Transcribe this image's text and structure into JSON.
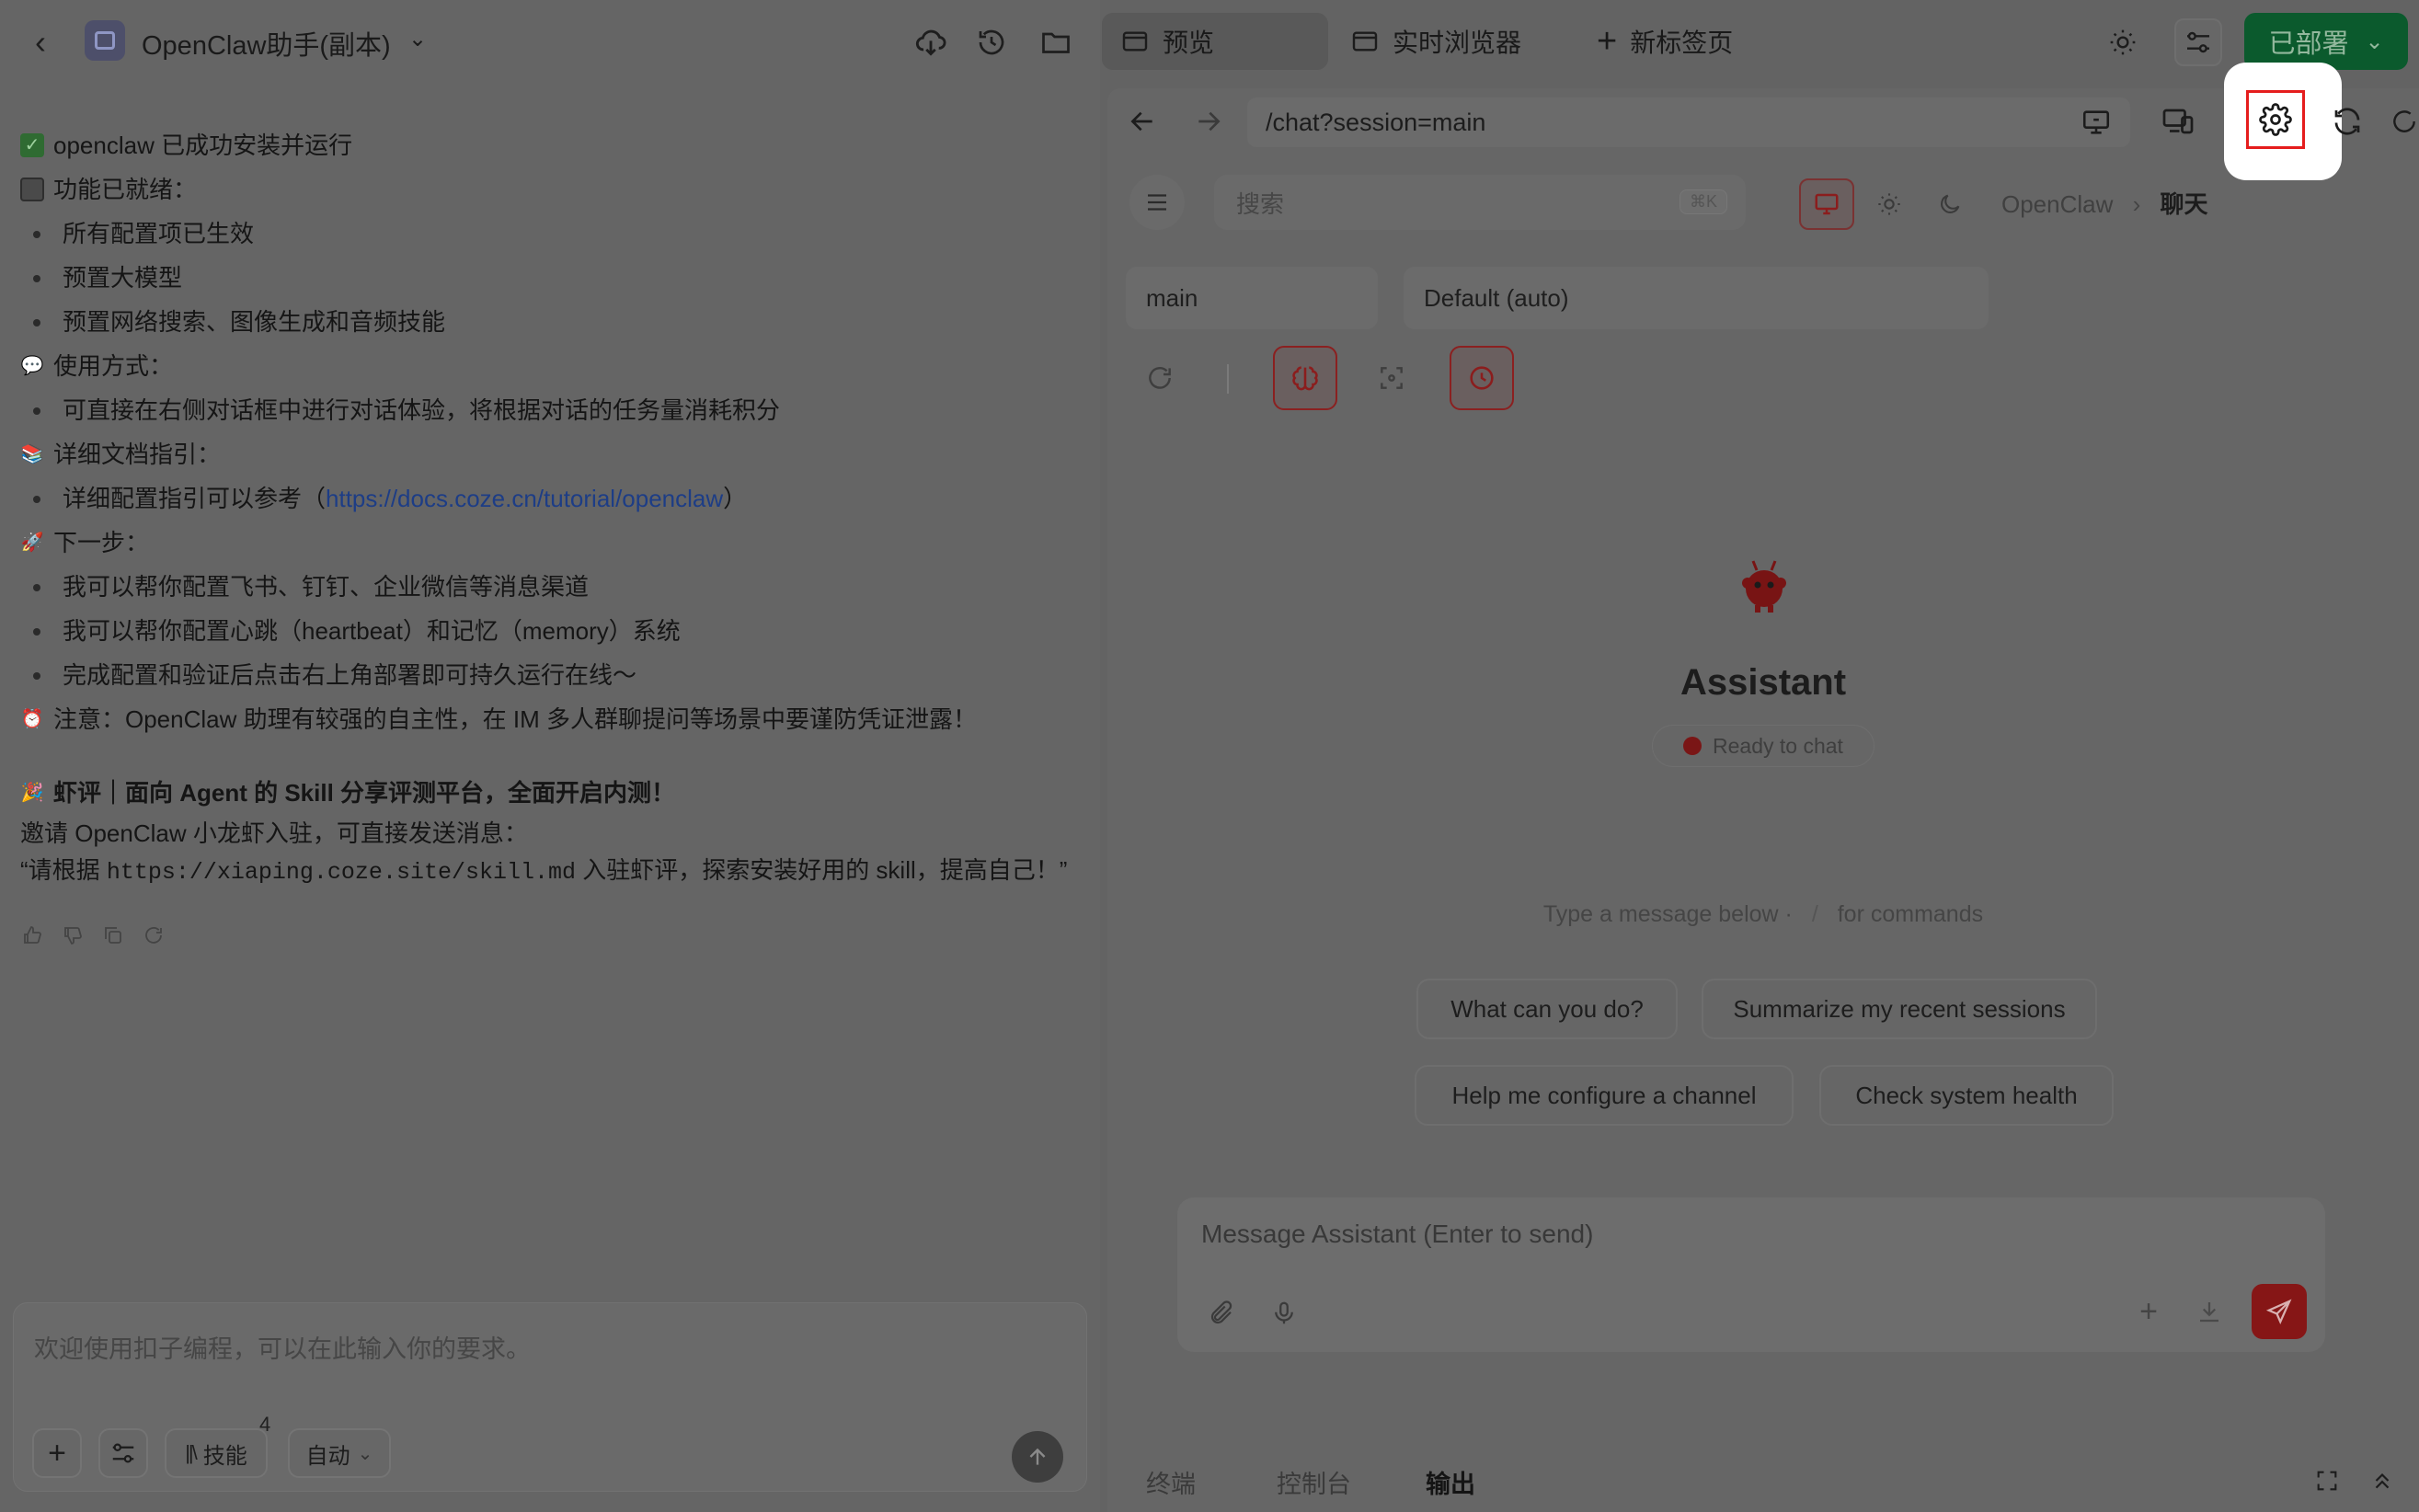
{
  "left": {
    "back_glyph": "‹",
    "project_title": "OpenClaw助手(副本)",
    "chevron": "⌄",
    "messages": {
      "line1": "openclaw 已成功安装并运行",
      "line2": "功能已就绪：",
      "bullets1": [
        "所有配置项已生效",
        "预置大模型",
        "预置网络搜索、图像生成和音频技能"
      ],
      "usage_title": "使用方式：",
      "usage_bullet": "可直接在右侧对话框中进行对话体验，将根据对话的任务量消耗积分",
      "docs_title": "详细文档指引：",
      "docs_prefix": "详细配置指引可以参考（",
      "docs_link": "https://docs.coze.cn/tutorial/openclaw",
      "docs_suffix": "）",
      "next_title": "下一步：",
      "next_bullets": [
        "我可以帮你配置飞书、钉钉、企业微信等消息渠道",
        "我可以帮你配置心跳（heartbeat）和记忆（memory）系统",
        "完成配置和验证后点击右上角部署即可持久运行在线～"
      ],
      "warning": "注意：OpenClaw 助理有较强的自主性，在 IM 多人群聊提问等场景中要谨防凭证泄露！",
      "promo_title": "虾评｜面向 Agent 的 Skill 分享评测平台，全面开启内测！",
      "invite": "邀请 OpenClaw 小龙虾入驻，可直接发送消息：",
      "quote_prefix": "“请根据 ",
      "quote_code": "https://xiaping.coze.site/skill.md",
      "quote_suffix": " 入驻虾评，探索安装好用的 skill，提高自己！”"
    },
    "composer": {
      "placeholder": "欢迎使用扣子编程，可以在此输入你的要求。",
      "add": "+",
      "skills_label": "技能",
      "skills_count": "4",
      "mode_label": "自动",
      "mode_chevron": "⌄"
    }
  },
  "right": {
    "tabs": [
      {
        "label": "预览"
      },
      {
        "label": "实时浏览器"
      },
      {
        "label": "新标签页"
      }
    ],
    "new_tab_glyph": "+",
    "deploy_label": "已部署",
    "deploy_chevron": "⌄",
    "address": "/chat?session=main",
    "app": {
      "search_placeholder": "搜索",
      "search_shortcut": "⌘K",
      "crumb_root": "OpenClaw",
      "crumb_sep": "›",
      "crumb_current": "聊天",
      "session_select": "main",
      "model_select": "Default (auto)",
      "assistant_name": "Assistant",
      "status": "Ready to chat",
      "hint_left": "Type a message below ·",
      "hint_slash": "/",
      "hint_right": "for commands",
      "suggestions": [
        "What can you do?",
        "Summarize my recent sessions",
        "Help me configure a channel",
        "Check system health"
      ],
      "message_placeholder": "Message Assistant (Enter to send)",
      "plus": "+"
    },
    "bottom_tabs": [
      "终端",
      "控制台",
      "输出"
    ],
    "highlight_color": "#e51d1d",
    "deploy_color": "#0b5a2d"
  }
}
